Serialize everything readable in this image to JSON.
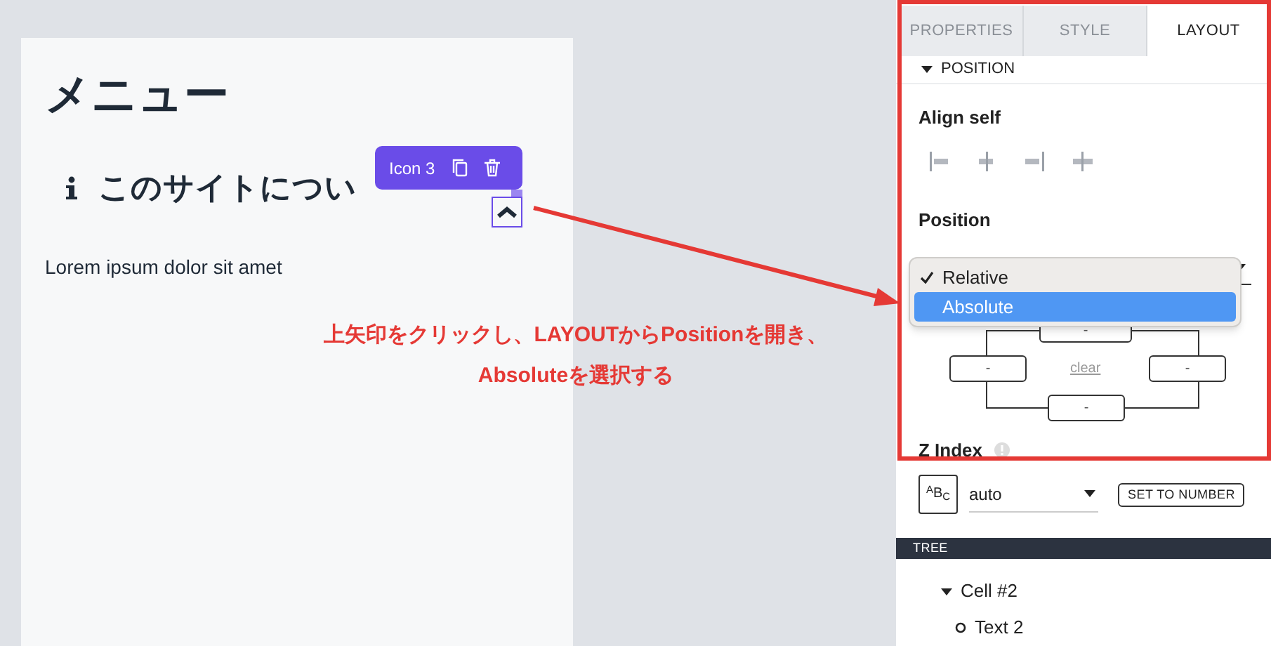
{
  "canvas": {
    "heading": "メニュー",
    "subheading": "このサイトについ",
    "body": "Lorem ipsum dolor sit amet",
    "toolbar": {
      "label": "Icon 3"
    }
  },
  "annotation": {
    "lines": [
      "上矢印をクリックし、LAYOUTからPositionを開き、",
      "Absoluteを選択する"
    ]
  },
  "panel": {
    "tabs": [
      {
        "label": "PROPERTIES",
        "selected": false
      },
      {
        "label": "STYLE",
        "selected": false
      },
      {
        "label": "LAYOUT",
        "selected": true
      }
    ],
    "section": {
      "label": "POSITION",
      "expanded": true
    },
    "align_self": {
      "label": "Align self"
    },
    "position": {
      "label": "Position",
      "options": [
        {
          "label": "Relative",
          "checked": true,
          "selected": false
        },
        {
          "label": "Absolute",
          "checked": false,
          "selected": true
        }
      ]
    },
    "spacing": {
      "top": "-",
      "left": "-",
      "right": "-",
      "bottom": "-",
      "clear": "clear"
    },
    "z_index": {
      "label": "Z Index",
      "type_label": "$^{A}$B$_{C}$",
      "value": "auto",
      "button": "SET TO NUMBER"
    }
  },
  "tree": {
    "title": "TREE",
    "items": [
      {
        "label": "Cell #2",
        "expanded": true,
        "children": [
          {
            "label": "Text 2"
          }
        ]
      }
    ]
  }
}
